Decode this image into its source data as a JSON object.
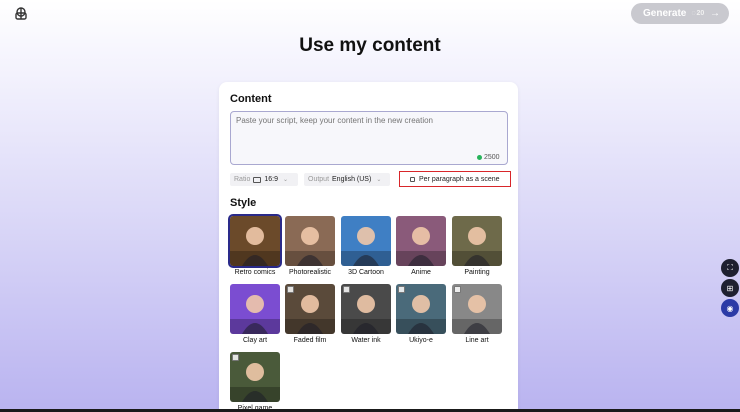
{
  "header": {
    "logo": "app-logo-icon",
    "generate": {
      "label": "Generate",
      "credits": "20",
      "arrow": "→"
    }
  },
  "page_title": "Use my content",
  "content": {
    "label": "Content",
    "placeholder": "Paste your script, keep your content in the new creation",
    "char_count": "2500",
    "ratio": {
      "label": "Ratio",
      "value": "16:9"
    },
    "output": {
      "label": "Output",
      "value": "English (US)"
    },
    "per_paragraph": "Per paragraph as a scene"
  },
  "style": {
    "label": "Style",
    "selected": "Retro comics",
    "items": [
      {
        "label": "Retro comics",
        "locked": false,
        "color": "#6b4a2a"
      },
      {
        "label": "Photorealistic",
        "locked": false,
        "color": "#8a6a55"
      },
      {
        "label": "3D Cartoon",
        "locked": false,
        "color": "#3f7fc4"
      },
      {
        "label": "Anime",
        "locked": false,
        "color": "#8a5a7a"
      },
      {
        "label": "Painting",
        "locked": false,
        "color": "#6e6a4a"
      },
      {
        "label": "Clay art",
        "locked": false,
        "color": "#7b4dd1"
      },
      {
        "label": "Faded film",
        "locked": true,
        "color": "#5a4a3a"
      },
      {
        "label": "Water ink",
        "locked": true,
        "color": "#4a4a4a"
      },
      {
        "label": "Ukiyo-e",
        "locked": true,
        "color": "#4a6a7a"
      },
      {
        "label": "Line art",
        "locked": true,
        "color": "#888888"
      },
      {
        "label": "Pixel game",
        "locked": true,
        "color": "#4a5a3a"
      }
    ]
  },
  "side_buttons": [
    "crop-icon",
    "grid-icon",
    "chat-icon"
  ]
}
